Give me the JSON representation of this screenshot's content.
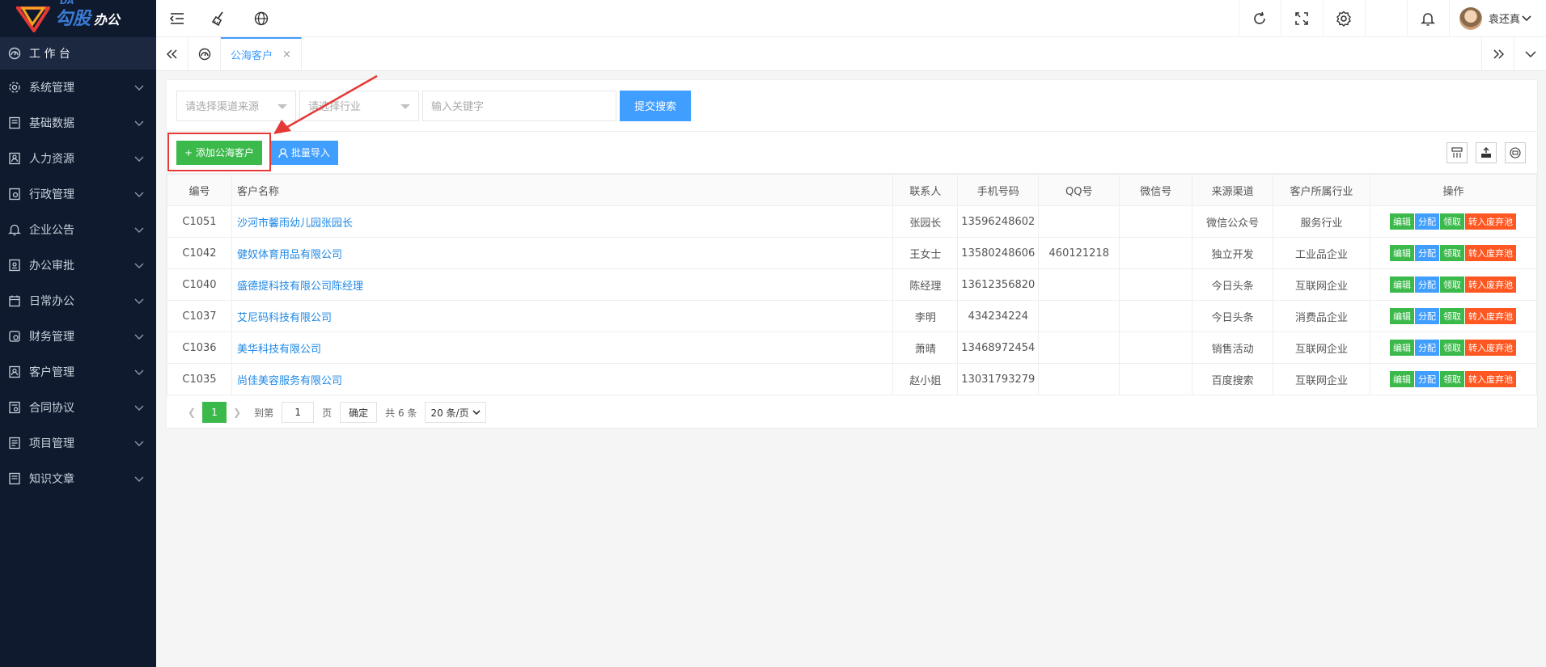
{
  "brand": {
    "small": "DA",
    "name": "勾股",
    "suffix": "办公"
  },
  "sidebar": {
    "home": "工 作 台",
    "items": [
      {
        "label": "系统管理",
        "icon": "gear-icon"
      },
      {
        "label": "基础数据",
        "icon": "database-icon"
      },
      {
        "label": "人力资源",
        "icon": "user-card-icon"
      },
      {
        "label": "行政管理",
        "icon": "admin-icon"
      },
      {
        "label": "企业公告",
        "icon": "bell-icon"
      },
      {
        "label": "办公审批",
        "icon": "approval-icon"
      },
      {
        "label": "日常办公",
        "icon": "calendar-icon"
      },
      {
        "label": "财务管理",
        "icon": "finance-icon"
      },
      {
        "label": "客户管理",
        "icon": "customer-icon"
      },
      {
        "label": "合同协议",
        "icon": "contract-icon"
      },
      {
        "label": "项目管理",
        "icon": "project-icon"
      },
      {
        "label": "知识文章",
        "icon": "article-icon"
      }
    ]
  },
  "user": {
    "name": "袁还真"
  },
  "tabs": {
    "active": "公海客户",
    "close": "×"
  },
  "search": {
    "channel_placeholder": "请选择渠道来源",
    "industry_placeholder": "请选择行业",
    "keyword_placeholder": "输入关键字",
    "submit_label": "提交搜索"
  },
  "toolbar": {
    "add_label": "+ 添加公海客户",
    "import_label": "批量导入"
  },
  "table": {
    "headers": [
      "编号",
      "客户名称",
      "联系人",
      "手机号码",
      "QQ号",
      "微信号",
      "来源渠道",
      "客户所属行业",
      "操作"
    ],
    "rows": [
      [
        "C1051",
        "沙河市馨雨幼儿园张园长",
        "张园长",
        "13596248602",
        "",
        "",
        "微信公众号",
        "服务行业"
      ],
      [
        "C1042",
        "健奴体育用品有限公司",
        "王女士",
        "13580248606",
        "460121218",
        "",
        "独立开发",
        "工业品企业"
      ],
      [
        "C1040",
        "盛德提科技有限公司陈经理",
        "陈经理",
        "13612356820",
        "",
        "",
        "今日头条",
        "互联网企业"
      ],
      [
        "C1037",
        "艾尼码科技有限公司",
        "李明",
        "434234224",
        "",
        "",
        "今日头条",
        "消费品企业"
      ],
      [
        "C1036",
        "美华科技有限公司",
        "萧晴",
        "13468972454",
        "",
        "",
        "销售活动",
        "互联网企业"
      ],
      [
        "C1035",
        "尚佳美容服务有限公司",
        "赵小姐",
        "13031793279",
        "",
        "",
        "百度搜索",
        "互联网企业"
      ]
    ],
    "ops": [
      "编辑",
      "分配",
      "领取",
      "转入废弃池"
    ]
  },
  "pager": {
    "current": "1",
    "goto": "到第",
    "page_value": "1",
    "page_unit": "页",
    "confirm": "确定",
    "total": "共 6 条",
    "size": "20 条/页"
  },
  "colors": {
    "sidebar_bg": "#0f1a2e",
    "primary": "#409eff",
    "success": "#3cb94b",
    "danger": "#ff5722",
    "highlight": "#e53935"
  }
}
